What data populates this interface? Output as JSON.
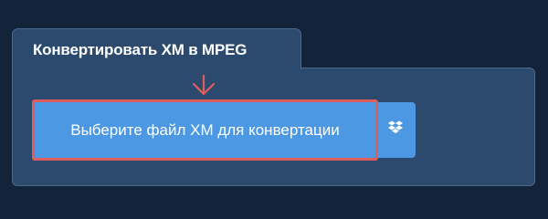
{
  "converter": {
    "title": "Конвертировать XM в MPEG",
    "select_file_label": "Выберите файл XM для конвертации",
    "dropbox_icon": "dropbox-icon",
    "hint_arrow_icon": "arrow-down-icon"
  },
  "colors": {
    "page_background": "#12233a",
    "panel_background": "#2c4a6e",
    "panel_border": "#4c698c",
    "button_background": "#4c98e2",
    "highlight": "#e05d5d",
    "text": "#ffffff"
  }
}
